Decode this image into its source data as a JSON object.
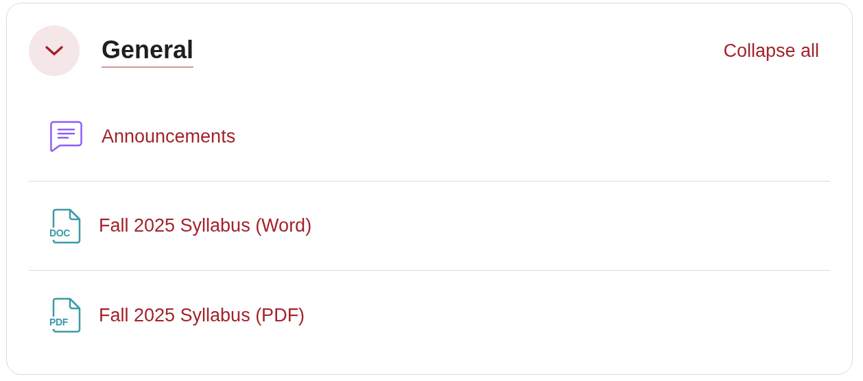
{
  "section": {
    "title": "General",
    "expanded": true,
    "collapse_link": "Collapse all",
    "items": [
      {
        "kind": "announcement",
        "label": "Announcements"
      },
      {
        "kind": "file",
        "file_type": "DOC",
        "label": "Fall 2025 Syllabus (Word)"
      },
      {
        "kind": "file",
        "file_type": "PDF",
        "label": "Fall 2025 Syllabus (PDF)"
      }
    ]
  }
}
